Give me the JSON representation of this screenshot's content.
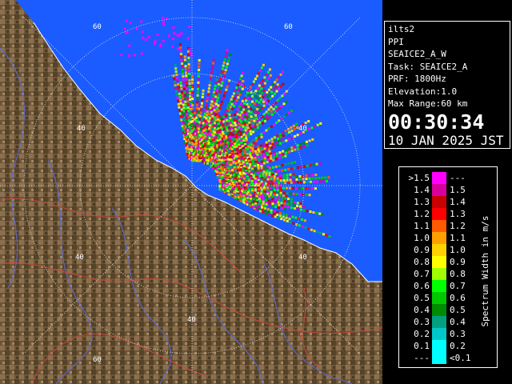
{
  "radar": {
    "range_ring_label": "40",
    "outer_ring_label": "60"
  },
  "info": {
    "site": "ilts2",
    "product": "PPI",
    "scan_name": "SEAICE2_A_W",
    "task": "Task: SEAICE2_A",
    "prf": "PRF: 1800Hz",
    "elevation": "Elevation:1.0",
    "max_range": "Max Range:60 km",
    "time": "00:30:34",
    "date": "10 JAN 2025 JST"
  },
  "legend": {
    "title": "Spectrum Width in m/s",
    "rows": [
      {
        "left": ">1.5",
        "right": "---",
        "color": "#ff00ff"
      },
      {
        "left": "1.4",
        "right": "1.5",
        "color": "#d8009c"
      },
      {
        "left": "1.3",
        "right": "1.4",
        "color": "#c80000"
      },
      {
        "left": "1.2",
        "right": "1.3",
        "color": "#ff0000"
      },
      {
        "left": "1.1",
        "right": "1.2",
        "color": "#ff5a00"
      },
      {
        "left": "1.0",
        "right": "1.1",
        "color": "#ffa000"
      },
      {
        "left": "0.9",
        "right": "1.0",
        "color": "#ffd200"
      },
      {
        "left": "0.8",
        "right": "0.9",
        "color": "#ffff00"
      },
      {
        "left": "0.7",
        "right": "0.8",
        "color": "#a0ff00"
      },
      {
        "left": "0.6",
        "right": "0.7",
        "color": "#00ff00"
      },
      {
        "left": "0.5",
        "right": "0.6",
        "color": "#00c800"
      },
      {
        "left": "0.4",
        "right": "0.5",
        "color": "#008c00"
      },
      {
        "left": "0.3",
        "right": "0.4",
        "color": "#00a080"
      },
      {
        "left": "0.2",
        "right": "0.3",
        "color": "#00c8c8"
      },
      {
        "left": "0.1",
        "right": "0.2",
        "color": "#00ffff"
      },
      {
        "left": "---",
        "right": "<0.1",
        "color": "#00ffff"
      }
    ]
  },
  "colors": {
    "sea": "#1a5cff",
    "land_dark": "#5a4628",
    "land_light": "#9c8060",
    "ring": "#ffffff"
  }
}
